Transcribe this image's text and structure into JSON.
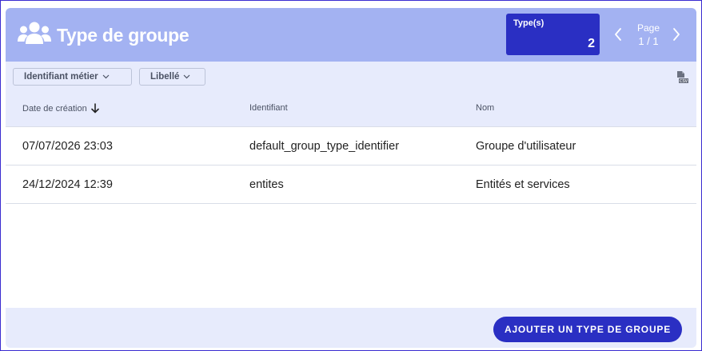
{
  "header": {
    "title": "Type de groupe",
    "icon": "users-icon",
    "count_label": "Type(s)",
    "count_value": "2",
    "pager_label": "Page",
    "pager_value": "1 / 1"
  },
  "toolbar": {
    "filters": [
      {
        "label": "Identifiant métier"
      },
      {
        "label": "Libellé"
      }
    ],
    "export_icon": "csv-file-icon"
  },
  "table": {
    "columns": [
      "Date de création",
      "Identifiant",
      "Nom"
    ],
    "sort_icon": "arrow-down-icon",
    "rows": [
      {
        "date": "07/07/2026 23:03",
        "identifiant": "default_group_type_identifier",
        "nom": "Groupe d'utilisateur"
      },
      {
        "date": "24/12/2024 12:39",
        "identifiant": "entites",
        "nom": "Entités et services"
      }
    ]
  },
  "footer": {
    "add_label": "AJOUTER UN TYPE DE GROUPE"
  },
  "colors": {
    "header_bg": "#a3b2f2",
    "toolbar_bg": "#e7ebfc",
    "accent": "#2a2fc3",
    "frame_border": "#3a2bd0"
  }
}
